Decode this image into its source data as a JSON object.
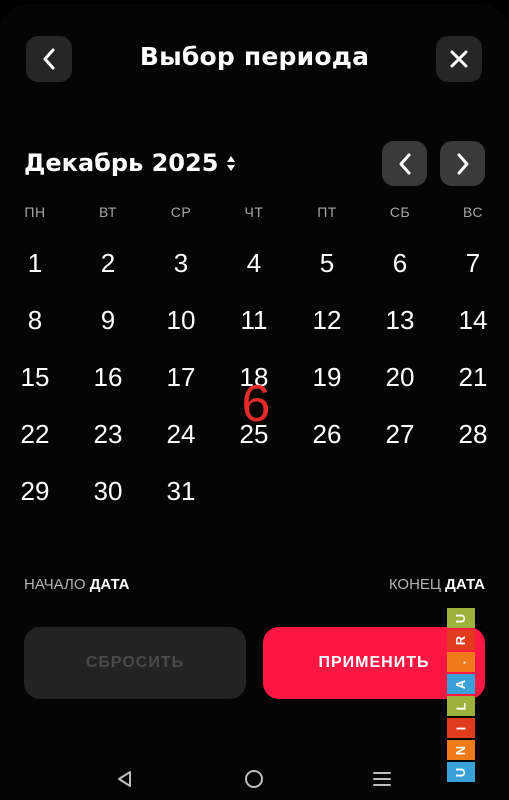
{
  "header": {
    "title": "Выбор периода",
    "back_icon": "chevron-left-icon",
    "close_icon": "close-icon"
  },
  "calendar": {
    "month_label": "Декабрь 2025",
    "weekdays": [
      "ПН",
      "ВТ",
      "СР",
      "ЧТ",
      "ПТ",
      "СБ",
      "ВС"
    ],
    "weeks": [
      [
        "1",
        "2",
        "3",
        "4",
        "5",
        "6",
        "7"
      ],
      [
        "8",
        "9",
        "10",
        "11",
        "12",
        "13",
        "14"
      ],
      [
        "15",
        "16",
        "17",
        "18",
        "19",
        "20",
        "21"
      ],
      [
        "22",
        "23",
        "24",
        "25",
        "26",
        "27",
        "28"
      ],
      [
        "29",
        "30",
        "31",
        "",
        "",
        "",
        ""
      ]
    ]
  },
  "overlay_number": "6",
  "period": {
    "start_muted": "НАЧАЛО",
    "start_strong": "ДАТА",
    "end_muted": "КОНЕЦ",
    "end_strong": "ДАТА"
  },
  "actions": {
    "reset_label": "СБРОСИТЬ",
    "apply_label": "ПРИМЕНИТЬ"
  },
  "watermark": {
    "letters": [
      "U",
      "N",
      "I",
      "L",
      "A",
      ".",
      "R",
      "U"
    ],
    "colors": [
      "#3aa0d8",
      "#ef7a1a",
      "#e13b1e",
      "#9bb33a",
      "#3aa0d8",
      "#ef7a1a",
      "#e13b1e",
      "#9bb33a"
    ]
  },
  "colors": {
    "accent": "#ff1744",
    "background": "#000000",
    "button_dark": "#232323"
  }
}
